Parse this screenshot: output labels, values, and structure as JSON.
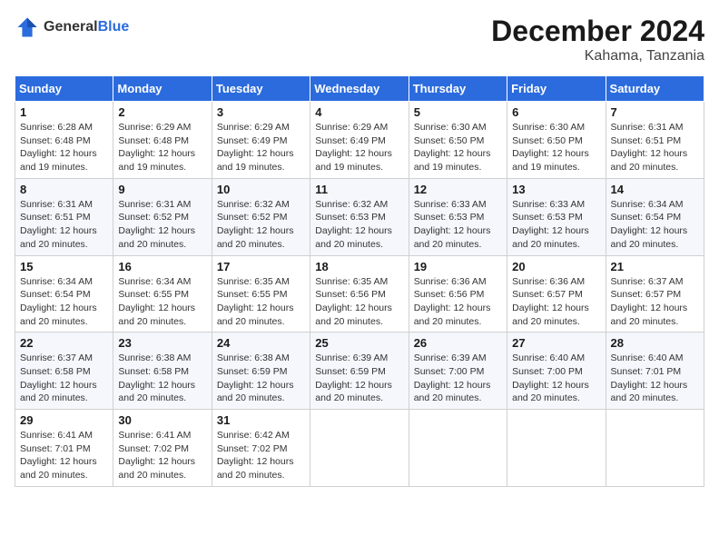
{
  "header": {
    "logo_line1": "General",
    "logo_line2": "Blue",
    "month_title": "December 2024",
    "location": "Kahama, Tanzania"
  },
  "weekdays": [
    "Sunday",
    "Monday",
    "Tuesday",
    "Wednesday",
    "Thursday",
    "Friday",
    "Saturday"
  ],
  "weeks": [
    [
      {
        "day": "1",
        "info": "Sunrise: 6:28 AM\nSunset: 6:48 PM\nDaylight: 12 hours\nand 19 minutes."
      },
      {
        "day": "2",
        "info": "Sunrise: 6:29 AM\nSunset: 6:48 PM\nDaylight: 12 hours\nand 19 minutes."
      },
      {
        "day": "3",
        "info": "Sunrise: 6:29 AM\nSunset: 6:49 PM\nDaylight: 12 hours\nand 19 minutes."
      },
      {
        "day": "4",
        "info": "Sunrise: 6:29 AM\nSunset: 6:49 PM\nDaylight: 12 hours\nand 19 minutes."
      },
      {
        "day": "5",
        "info": "Sunrise: 6:30 AM\nSunset: 6:50 PM\nDaylight: 12 hours\nand 19 minutes."
      },
      {
        "day": "6",
        "info": "Sunrise: 6:30 AM\nSunset: 6:50 PM\nDaylight: 12 hours\nand 19 minutes."
      },
      {
        "day": "7",
        "info": "Sunrise: 6:31 AM\nSunset: 6:51 PM\nDaylight: 12 hours\nand 20 minutes."
      }
    ],
    [
      {
        "day": "8",
        "info": "Sunrise: 6:31 AM\nSunset: 6:51 PM\nDaylight: 12 hours\nand 20 minutes."
      },
      {
        "day": "9",
        "info": "Sunrise: 6:31 AM\nSunset: 6:52 PM\nDaylight: 12 hours\nand 20 minutes."
      },
      {
        "day": "10",
        "info": "Sunrise: 6:32 AM\nSunset: 6:52 PM\nDaylight: 12 hours\nand 20 minutes."
      },
      {
        "day": "11",
        "info": "Sunrise: 6:32 AM\nSunset: 6:53 PM\nDaylight: 12 hours\nand 20 minutes."
      },
      {
        "day": "12",
        "info": "Sunrise: 6:33 AM\nSunset: 6:53 PM\nDaylight: 12 hours\nand 20 minutes."
      },
      {
        "day": "13",
        "info": "Sunrise: 6:33 AM\nSunset: 6:53 PM\nDaylight: 12 hours\nand 20 minutes."
      },
      {
        "day": "14",
        "info": "Sunrise: 6:34 AM\nSunset: 6:54 PM\nDaylight: 12 hours\nand 20 minutes."
      }
    ],
    [
      {
        "day": "15",
        "info": "Sunrise: 6:34 AM\nSunset: 6:54 PM\nDaylight: 12 hours\nand 20 minutes."
      },
      {
        "day": "16",
        "info": "Sunrise: 6:34 AM\nSunset: 6:55 PM\nDaylight: 12 hours\nand 20 minutes."
      },
      {
        "day": "17",
        "info": "Sunrise: 6:35 AM\nSunset: 6:55 PM\nDaylight: 12 hours\nand 20 minutes."
      },
      {
        "day": "18",
        "info": "Sunrise: 6:35 AM\nSunset: 6:56 PM\nDaylight: 12 hours\nand 20 minutes."
      },
      {
        "day": "19",
        "info": "Sunrise: 6:36 AM\nSunset: 6:56 PM\nDaylight: 12 hours\nand 20 minutes."
      },
      {
        "day": "20",
        "info": "Sunrise: 6:36 AM\nSunset: 6:57 PM\nDaylight: 12 hours\nand 20 minutes."
      },
      {
        "day": "21",
        "info": "Sunrise: 6:37 AM\nSunset: 6:57 PM\nDaylight: 12 hours\nand 20 minutes."
      }
    ],
    [
      {
        "day": "22",
        "info": "Sunrise: 6:37 AM\nSunset: 6:58 PM\nDaylight: 12 hours\nand 20 minutes."
      },
      {
        "day": "23",
        "info": "Sunrise: 6:38 AM\nSunset: 6:58 PM\nDaylight: 12 hours\nand 20 minutes."
      },
      {
        "day": "24",
        "info": "Sunrise: 6:38 AM\nSunset: 6:59 PM\nDaylight: 12 hours\nand 20 minutes."
      },
      {
        "day": "25",
        "info": "Sunrise: 6:39 AM\nSunset: 6:59 PM\nDaylight: 12 hours\nand 20 minutes."
      },
      {
        "day": "26",
        "info": "Sunrise: 6:39 AM\nSunset: 7:00 PM\nDaylight: 12 hours\nand 20 minutes."
      },
      {
        "day": "27",
        "info": "Sunrise: 6:40 AM\nSunset: 7:00 PM\nDaylight: 12 hours\nand 20 minutes."
      },
      {
        "day": "28",
        "info": "Sunrise: 6:40 AM\nSunset: 7:01 PM\nDaylight: 12 hours\nand 20 minutes."
      }
    ],
    [
      {
        "day": "29",
        "info": "Sunrise: 6:41 AM\nSunset: 7:01 PM\nDaylight: 12 hours\nand 20 minutes."
      },
      {
        "day": "30",
        "info": "Sunrise: 6:41 AM\nSunset: 7:02 PM\nDaylight: 12 hours\nand 20 minutes."
      },
      {
        "day": "31",
        "info": "Sunrise: 6:42 AM\nSunset: 7:02 PM\nDaylight: 12 hours\nand 20 minutes."
      },
      {
        "day": "",
        "info": ""
      },
      {
        "day": "",
        "info": ""
      },
      {
        "day": "",
        "info": ""
      },
      {
        "day": "",
        "info": ""
      }
    ]
  ]
}
